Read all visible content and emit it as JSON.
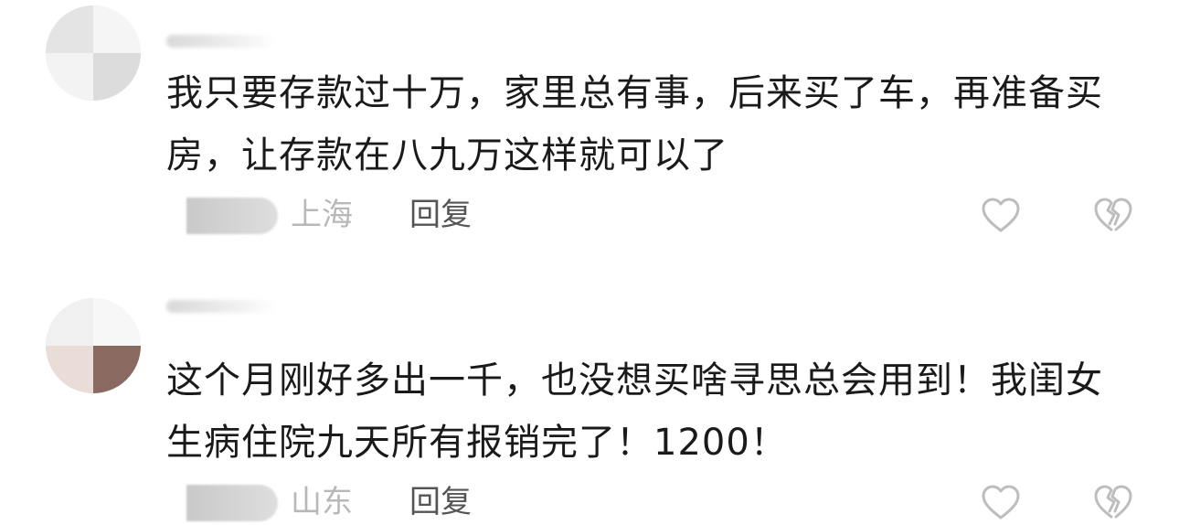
{
  "comments": [
    {
      "text": "我只要存款过十万，家里总有事，后来买了车，再准备买房，让存款在八九万这样就可以了",
      "location": "上海",
      "reply_label": "回复"
    },
    {
      "text": "这个月刚好多出一千，也没想买啥寻思总会用到！我闺女生病住院九天所有报销完了！1200！",
      "location": "山东",
      "reply_label": "回复"
    }
  ],
  "icons": {
    "like": "heart-outline-icon",
    "dislike": "broken-heart-icon"
  },
  "colors": {
    "text": "#1a1a1a",
    "meta": "#b8b8b8",
    "reply": "#555555",
    "icon": "#bdbdbd"
  }
}
